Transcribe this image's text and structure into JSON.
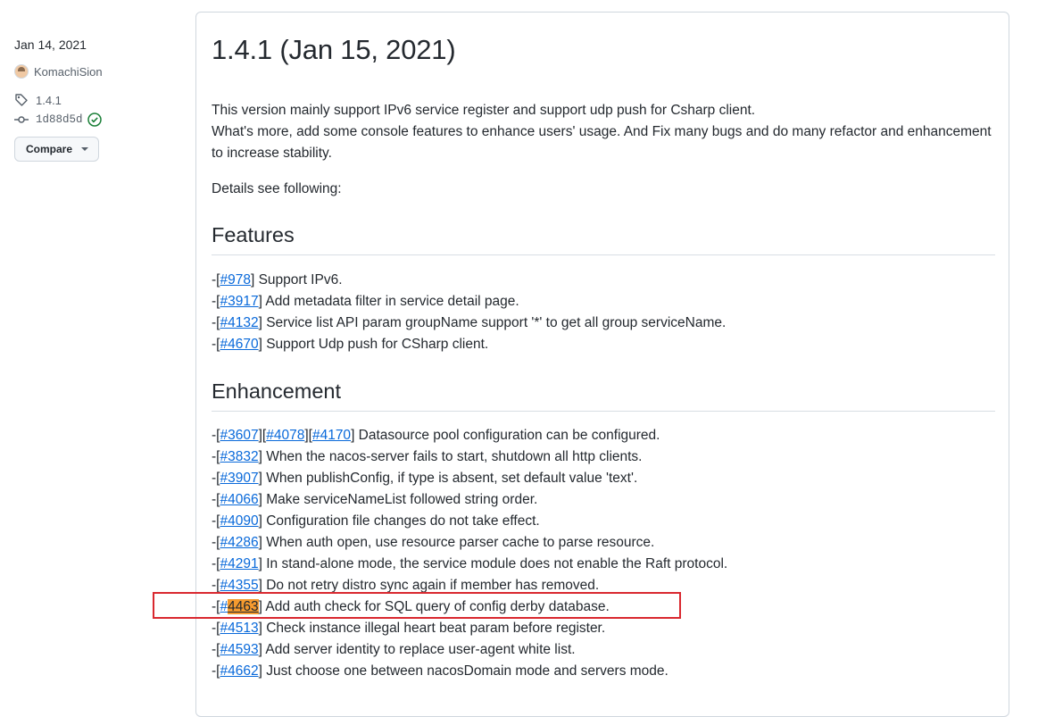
{
  "sidebar": {
    "date": "Jan 14, 2021",
    "author": "KomachiSion",
    "tag": "1.4.1",
    "commit": "1d88d5d",
    "compare_label": "Compare"
  },
  "release": {
    "title": "1.4.1 (Jan 15, 2021)",
    "intro_line1": "This version mainly support IPv6 service register and support udp push for Csharp client.",
    "intro_line2": "What's more, add some console features to enhance users' usage. And Fix many bugs and do many refactor and enhancement to increase stability.",
    "details": "Details see following:",
    "features_heading": "Features",
    "enhancement_heading": "Enhancement"
  },
  "features": [
    {
      "issues": [
        "#978"
      ],
      "text": "Support IPv6."
    },
    {
      "issues": [
        "#3917"
      ],
      "text": "Add metadata filter in service detail page."
    },
    {
      "issues": [
        "#4132"
      ],
      "text": "Service list API param groupName support '*' to get all group serviceName."
    },
    {
      "issues": [
        "#4670"
      ],
      "text": "Support Udp push for CSharp client."
    }
  ],
  "enhancements": [
    {
      "issues": [
        "#3607",
        "#4078",
        "#4170"
      ],
      "text": "Datasource pool configuration can be configured."
    },
    {
      "issues": [
        "#3832"
      ],
      "text": "When the nacos-server fails to start, shutdown all http clients."
    },
    {
      "issues": [
        "#3907"
      ],
      "text": "When publishConfig, if type is absent, set default value 'text'."
    },
    {
      "issues": [
        "#4066"
      ],
      "text": "Make serviceNameList followed string order."
    },
    {
      "issues": [
        "#4090"
      ],
      "text": "Configuration file changes do not take effect."
    },
    {
      "issues": [
        "#4286"
      ],
      "text": "When auth open, use resource parser cache to parse resource."
    },
    {
      "issues": [
        "#4291"
      ],
      "text": "In stand-alone mode, the service module does not enable the Raft protocol."
    },
    {
      "issues": [
        "#4355"
      ],
      "text": "Do not retry distro sync again if member has removed."
    },
    {
      "issues": [
        "#4463"
      ],
      "text": "Add auth check for SQL query of config derby database.",
      "highlight": true
    },
    {
      "issues": [
        "#4513"
      ],
      "text": "Check instance illegal heart beat param before register."
    },
    {
      "issues": [
        "#4593"
      ],
      "text": "Add server identity to replace user-agent white list."
    },
    {
      "issues": [
        "#4662"
      ],
      "text": "Just choose one between nacosDomain mode and servers mode."
    }
  ],
  "colors": {
    "link": "#0969da",
    "highlight": "#f59a2e",
    "annotation_box": "#d9282f",
    "verified": "#1a7f37"
  }
}
